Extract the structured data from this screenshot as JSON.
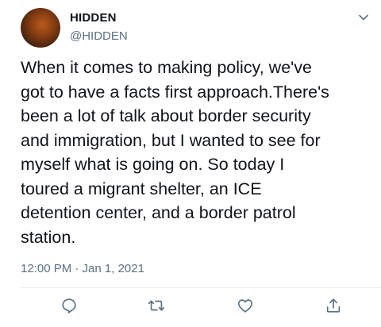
{
  "tweet": {
    "author": {
      "display_name": "HIDDEN",
      "handle": "@HIDDEN"
    },
    "text": "When it comes to making policy, we've\ngot to have a facts first approach.There's\nbeen a lot of talk about border security\nand immigration, but I wanted to see for\nmyself what is going on. So today I\ntoured a migrant shelter, an ICE\ndetention center, and a border patrol\nstation.",
    "timestamp": "12:00 PM · Jan 1, 2021"
  },
  "actions": {
    "icons": [
      "reply-icon",
      "retweet-icon",
      "like-icon",
      "share-icon"
    ]
  },
  "colors": {
    "text": "#0f1419",
    "secondary": "#5b7083",
    "divider": "#e6ecf0"
  }
}
